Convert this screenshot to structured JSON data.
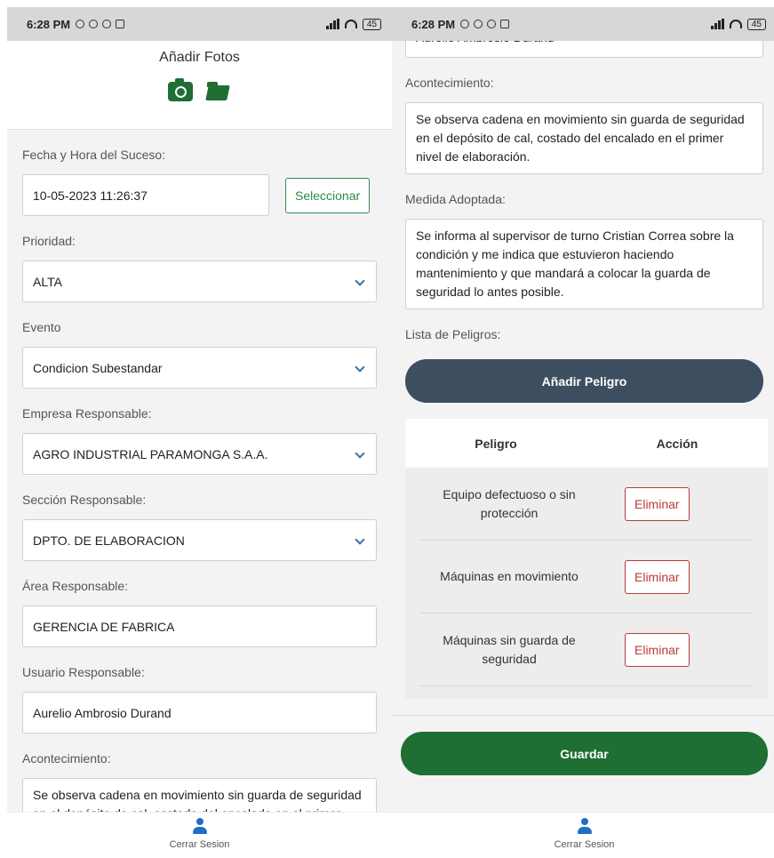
{
  "status_bar": {
    "time": "6:28 PM",
    "battery": "45"
  },
  "left_screen": {
    "photos_title": "Añadir Fotos",
    "fields": {
      "fecha_label": "Fecha y Hora del Suceso:",
      "fecha_value": "10-05-2023 11:26:37",
      "seleccionar_label": "Seleccionar",
      "prioridad_label": "Prioridad:",
      "prioridad_value": "ALTA",
      "evento_label": "Evento",
      "evento_value": "Condicion Subestandar",
      "empresa_label": "Empresa Responsable:",
      "empresa_value": "AGRO INDUSTRIAL PARAMONGA S.A.A.",
      "seccion_label": "Sección Responsable:",
      "seccion_value": "DPTO. DE ELABORACION",
      "area_label": "Área Responsable:",
      "area_value": "GERENCIA DE FABRICA",
      "usuario_label": "Usuario Responsable:",
      "usuario_value": "Aurelio Ambrosio Durand",
      "acontecimiento_label": "Acontecimiento:",
      "acontecimiento_value": "Se observa cadena en movimiento sin guarda de seguridad en el depósito de cal, costado del encalado en el primer nivel de elaboración."
    },
    "nav_label": "Cerrar Sesion"
  },
  "right_screen": {
    "usuario_value": "Aurelio Ambrosio Durand",
    "acontecimiento_label": "Acontecimiento:",
    "acontecimiento_value": "Se observa cadena en movimiento sin guarda de seguridad en el depósito de cal, costado del encalado en el primer nivel de elaboración.",
    "medida_label": "Medida Adoptada:",
    "medida_value": "Se informa al supervisor de turno Cristian Correa sobre la condición y me indica que estuvieron haciendo mantenimiento y que mandará a colocar la guarda de seguridad lo antes posible.",
    "lista_label": "Lista de Peligros:",
    "add_button": "Añadir Peligro",
    "table": {
      "headers": [
        "Peligro",
        "Acción"
      ],
      "rows": [
        {
          "peligro": "Equipo defectuoso o sin protección",
          "accion": "Eliminar"
        },
        {
          "peligro": "Máquinas en movimiento",
          "accion": "Eliminar"
        },
        {
          "peligro": "Máquinas sin guarda de seguridad",
          "accion": "Eliminar"
        }
      ]
    },
    "save_button": "Guardar",
    "nav_label": "Cerrar Sesion"
  },
  "colors": {
    "primary_green": "#1f6e34",
    "dark_button": "#3d4e60",
    "danger": "#b93a3a",
    "nav_icon": "#1f6fc4"
  },
  "icons": [
    "camera-icon",
    "folder-icon",
    "chevron-down-icon",
    "user-icon"
  ]
}
